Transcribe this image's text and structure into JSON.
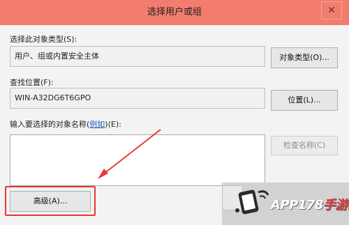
{
  "window": {
    "title": "选择用户或组",
    "close_glyph": "✕"
  },
  "object_type": {
    "label": "选择此对象类型(S):",
    "value": "用户、组或内置安全主体",
    "button": "对象类型(O)..."
  },
  "location": {
    "label": "查找位置(F):",
    "value": "WIN-A32DG6T6GPO",
    "button": "位置(L)..."
  },
  "names": {
    "label_prefix": "输入要选择的对象名称(",
    "label_link": "例如",
    "label_suffix": ")(E):",
    "value": "",
    "check_button": "检查名称(C)"
  },
  "advanced_button": "高级(A)...",
  "watermark": {
    "text_main": "APP178",
    "text_accent": "手游网",
    "url": ".com"
  },
  "colors": {
    "titlebar": "#f27d6e",
    "highlight": "#e53935",
    "arrow": "#e53935"
  }
}
